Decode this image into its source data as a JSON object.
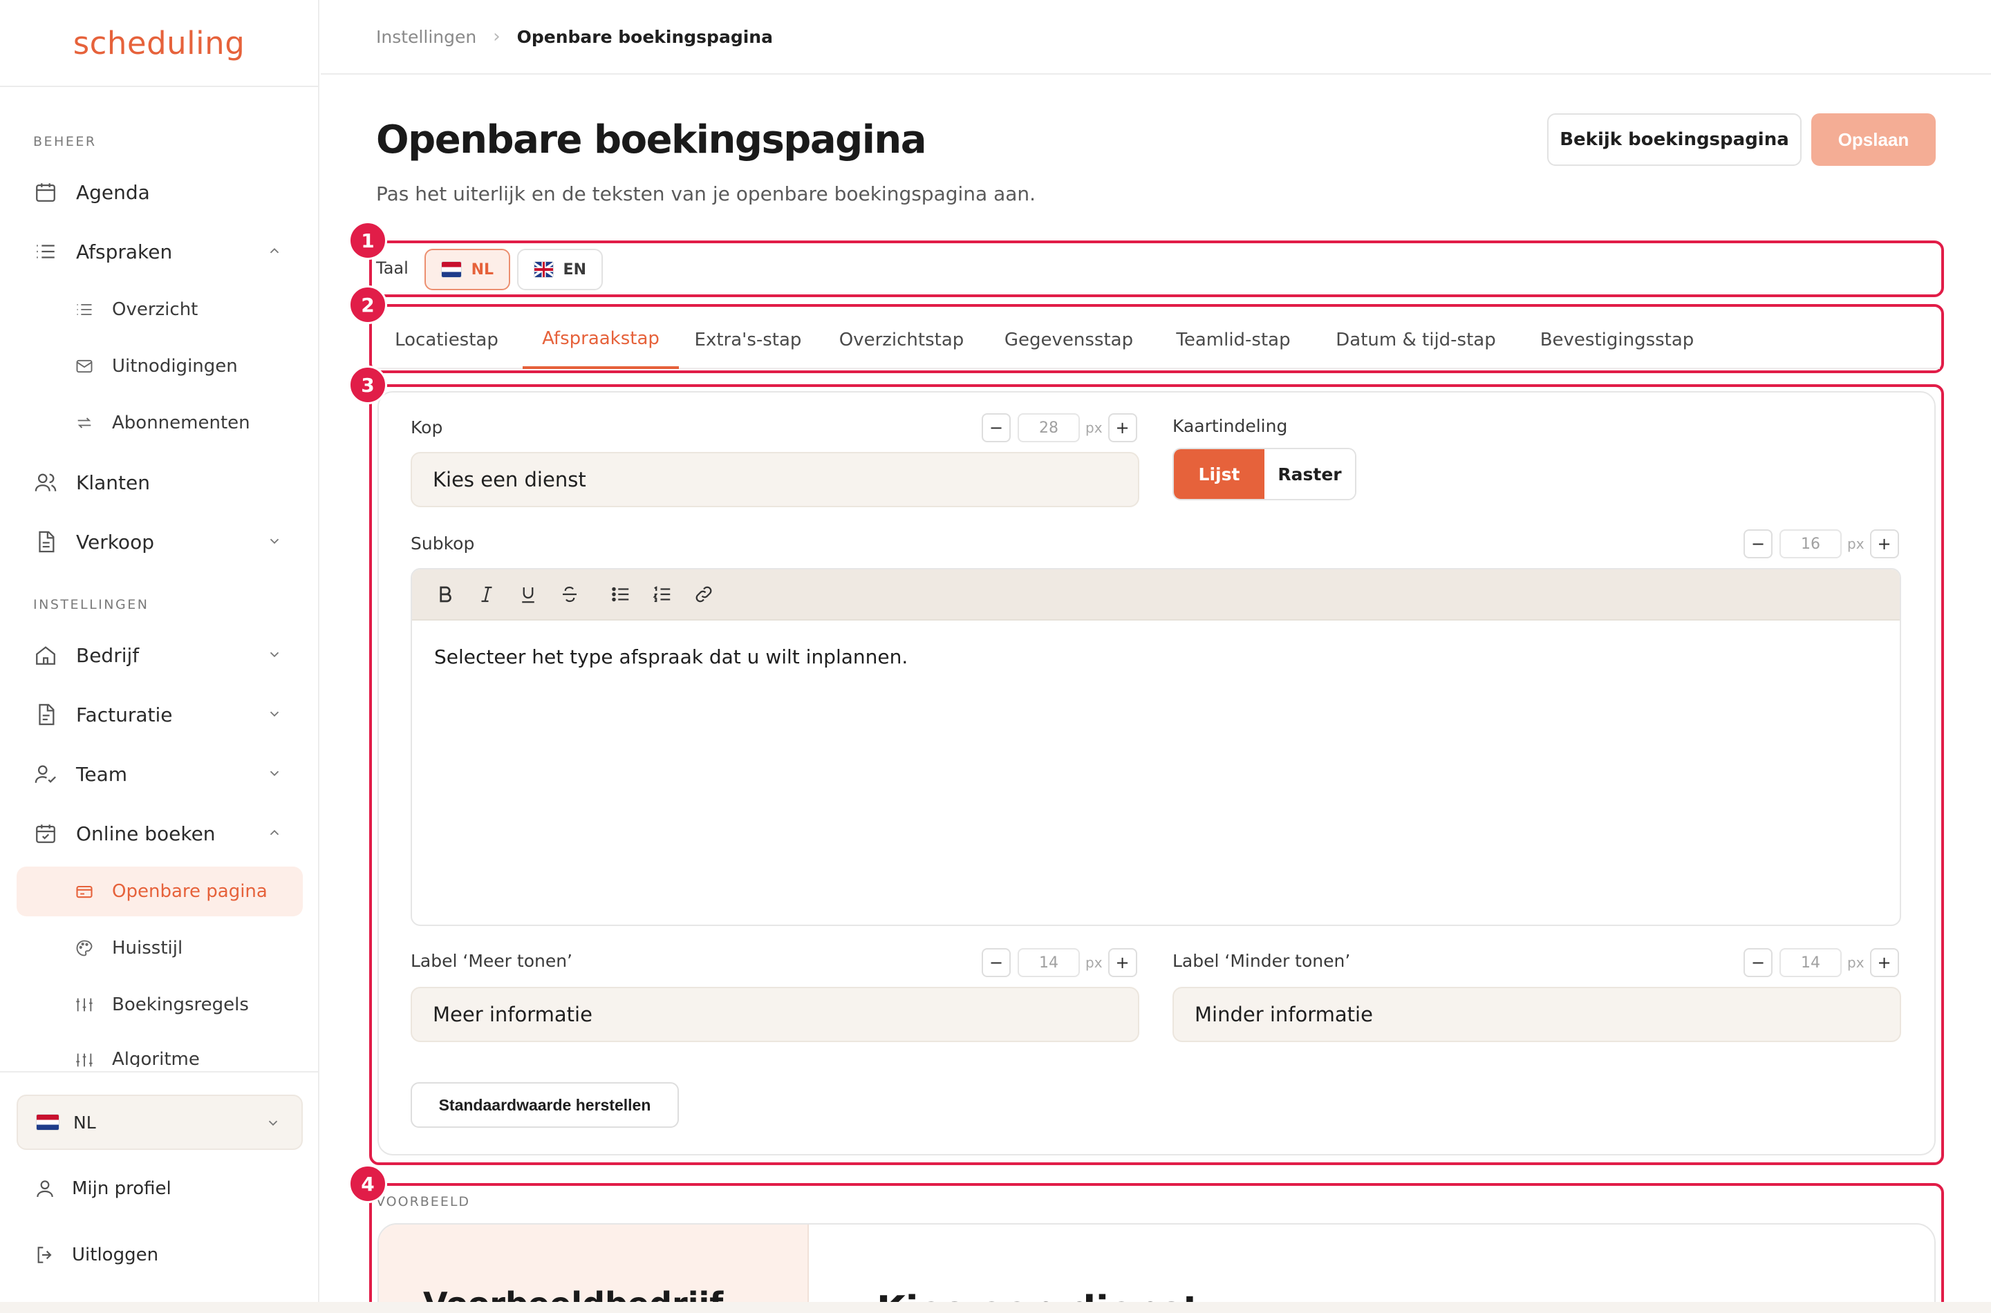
{
  "brand": {
    "logo_text": "scheduling",
    "accent": "#e6623b",
    "annotation_color": "#e11d48"
  },
  "sidebar": {
    "sections": {
      "beheer": "BEHEER",
      "instellingen": "INSTELLINGEN"
    },
    "items": {
      "agenda": "Agenda",
      "afspraken": "Afspraken",
      "overzicht": "Overzicht",
      "uitnodigingen": "Uitnodigingen",
      "abonnementen": "Abonnementen",
      "klanten": "Klanten",
      "verkoop": "Verkoop",
      "bedrijf": "Bedrijf",
      "facturatie": "Facturatie",
      "team": "Team",
      "online_boeken": "Online boeken",
      "openbare_pagina": "Openbare pagina",
      "huisstijl": "Huisstijl",
      "boekingsregels": "Boekingsregels",
      "algoritme": "Algoritme"
    },
    "language": "NL",
    "profile": "Mijn profiel",
    "logout": "Uitloggen"
  },
  "breadcrumb": {
    "parent": "Instellingen",
    "separator": "›",
    "current": "Openbare boekingspagina"
  },
  "header": {
    "title": "Openbare boekingspagina",
    "subtitle": "Pas het uiterlijk en de teksten van je openbare boekingspagina aan.",
    "view_button": "Bekijk boekingspagina",
    "save_button": "Opslaan"
  },
  "annotations": [
    "1",
    "2",
    "3",
    "4"
  ],
  "language_row": {
    "label": "Taal",
    "options": [
      "NL",
      "EN"
    ],
    "selected": "NL"
  },
  "tabs": [
    "Locatiestap",
    "Afspraakstap",
    "Extra's-stap",
    "Overzichtstap",
    "Gegevensstap",
    "Teamlid-stap",
    "Datum & tijd-stap",
    "Bevestigingsstap"
  ],
  "active_tab": "Afspraakstap",
  "editor": {
    "kop": {
      "label": "Kop",
      "value": "Kies een dienst",
      "size": "28",
      "unit": "px"
    },
    "kaartindeling": {
      "label": "Kaartindeling",
      "options": [
        "Lijst",
        "Raster"
      ],
      "selected": "Lijst"
    },
    "subkop": {
      "label": "Subkop",
      "value": "Selecteer het type afspraak dat u wilt inplannen.",
      "size": "16",
      "unit": "px"
    },
    "meer_tonen": {
      "label": "Label ‘Meer tonen’",
      "value": "Meer informatie",
      "size": "14",
      "unit": "px"
    },
    "minder_tonen": {
      "label": "Label ‘Minder tonen’",
      "value": "Minder informatie",
      "size": "14",
      "unit": "px"
    },
    "reset_button": "Standaardwaarde herstellen",
    "stepper_minus": "−",
    "stepper_plus": "+"
  },
  "preview": {
    "label": "VOORBEELD",
    "company": "Voorbeeldbedrijf",
    "heading": "Kies een dienst"
  }
}
